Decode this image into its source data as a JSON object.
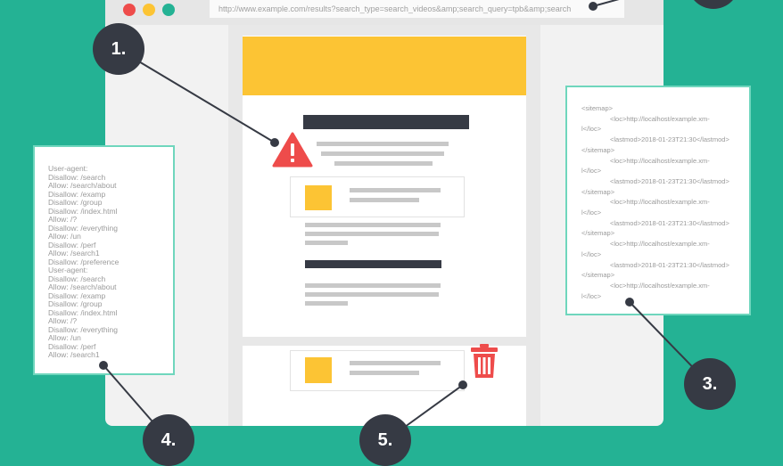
{
  "browser": {
    "url": "http://www.example.com/results?search_type=search_videos&amp;search_query=tpb&amp;search",
    "window_dots": [
      "#ee4c4b",
      "#fcc434",
      "#24b294"
    ]
  },
  "callouts": [
    "1.",
    "3.",
    "4.",
    "5."
  ],
  "robots_txt": [
    "User-agent:",
    "Disallow: /search",
    "Allow: /search/about",
    "Disallow: /examp",
    "Disallow: /group",
    "Disallow: /index.html",
    "Allow: /?",
    "Disallow: /everything",
    "Allow: /un",
    "Disallow: /perf",
    "Allow: /search1",
    "Disallow: /preference",
    "User-agent:",
    "Disallow: /search",
    "Allow: /search/about",
    "Disallow: /examp",
    "Disallow: /group",
    "Disallow: /index.html",
    "Allow: /?",
    "Disallow: /everything",
    "Allow: /un",
    "Disallow: /perf",
    "Allow: /search1"
  ],
  "sitemap_xml": [
    "<sitemap>",
    "<loc>http://localhost/example.xm-",
    "l</loc>",
    "<lastmod>2018-01-23T21:30</lastmod>",
    "</sitemap>",
    "<loc>http://localhost/example.xm-",
    "l</loc>",
    "<lastmod>2018-01-23T21:30</lastmod>",
    "</sitemap>",
    "<loc>http://localhost/example.xm-",
    "l</loc>",
    "<lastmod>2018-01-23T21:30</lastmod>",
    "</sitemap>",
    "<loc>http://localhost/example.xm-",
    "l</loc>",
    "<lastmod>2018-01-23T21:30</lastmod>",
    "</sitemap>",
    "<loc>http://localhost/example.xm-",
    "l</loc>"
  ],
  "colors": {
    "background": "#24b294",
    "accent_yellow": "#fcc434",
    "warning_red": "#ee4c4b",
    "dark": "#363a44"
  },
  "icons": [
    "warning-triangle-icon",
    "trash-icon"
  ]
}
